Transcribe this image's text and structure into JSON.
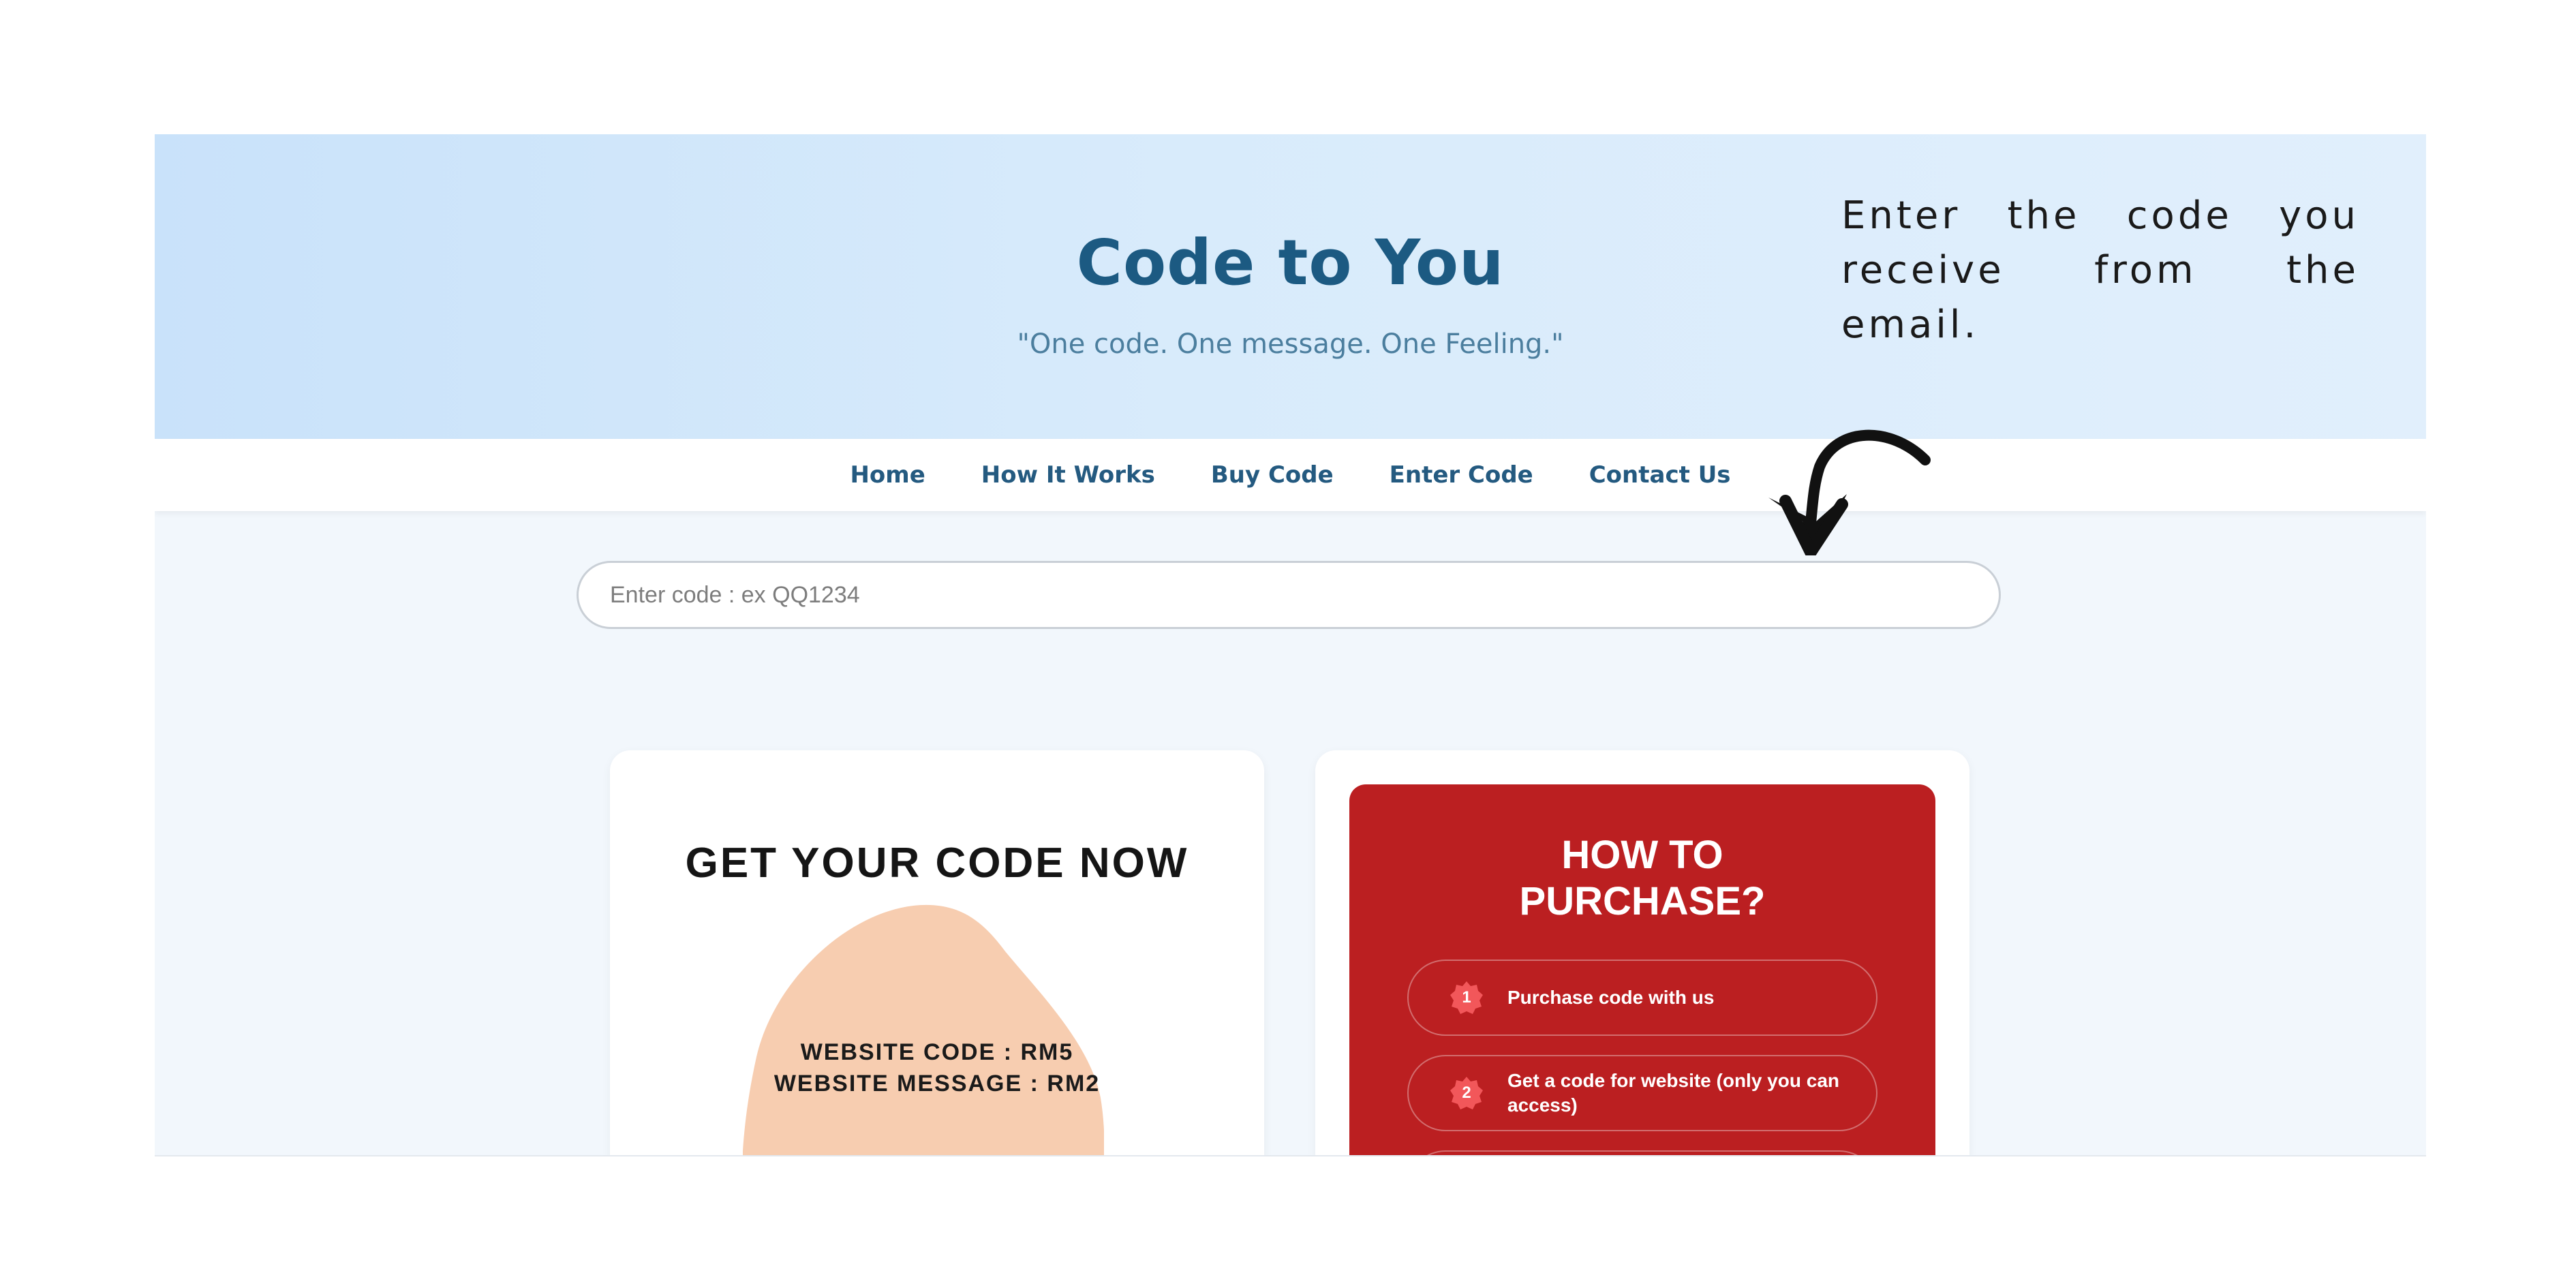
{
  "header": {
    "title": "Code to You",
    "tagline": "\"One code. One message. One Feeling.\""
  },
  "nav": {
    "items": [
      {
        "label": "Home"
      },
      {
        "label": "How It Works"
      },
      {
        "label": "Buy Code"
      },
      {
        "label": "Enter Code"
      },
      {
        "label": "Contact Us"
      }
    ]
  },
  "code_input": {
    "placeholder": "Enter code : ex QQ1234",
    "value": ""
  },
  "promo_card": {
    "title": "GET YOUR CODE NOW",
    "lines": [
      "WEBSITE CODE : RM5",
      "WEBSITE MESSAGE : RM2"
    ]
  },
  "howto_card": {
    "title": "HOW TO\nPURCHASE?",
    "steps": [
      {
        "number": "1",
        "text": "Purchase code with us"
      },
      {
        "number": "2",
        "text": "Get a code for website (only you can access)"
      }
    ]
  },
  "annotation": {
    "text": "Enter the code you receive from the email."
  },
  "colors": {
    "brand_blue": "#1c5a82",
    "hero_bg": "#d8ebfb",
    "accent_red": "#bb1f21",
    "blob_peach": "#f7cdb0"
  }
}
